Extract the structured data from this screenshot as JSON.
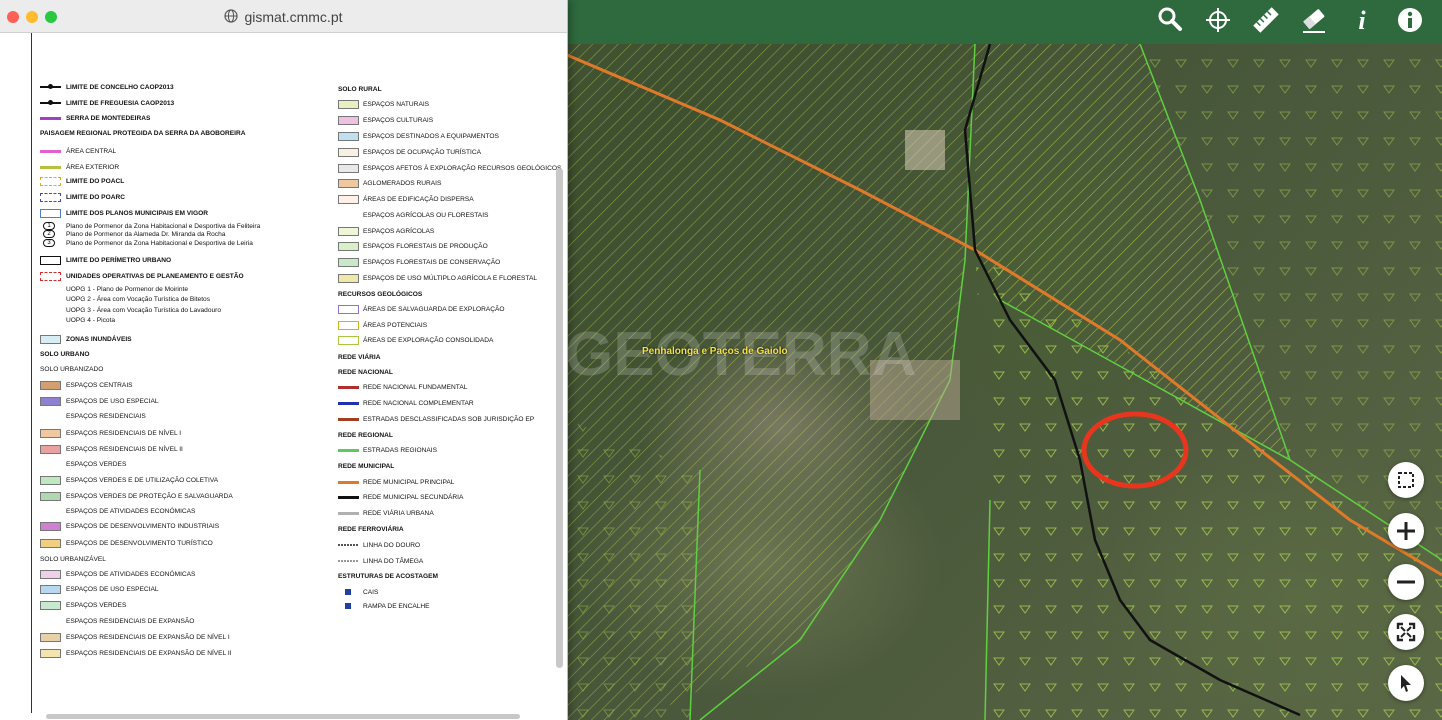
{
  "window": {
    "url": "gismat.cmmc.pt"
  },
  "map": {
    "place_label": "Penhalonga e Paços de Gaiolo"
  },
  "toolbar": {
    "icons": [
      "search-icon",
      "crosshair-icon",
      "ruler-icon",
      "eraser-icon",
      "info-italic-icon",
      "info-circle-icon"
    ]
  },
  "controls": {
    "icons": [
      "select-area-icon",
      "zoom-in-icon",
      "zoom-out-icon",
      "fullscreen-icon",
      "pointer-icon"
    ]
  },
  "legend_left": [
    {
      "text": "LIMITE DE CONCELHO  CAOP2013",
      "bold": true
    },
    {
      "text": "LIMITE DE FREGUESIA  CAOP2013",
      "bold": true
    },
    {
      "text": "SERRA DE MONTEDEIRAS",
      "bold": true
    },
    {
      "text": "PAISAGEM REGIONAL PROTEGIDA DA SERRA DA ABOBOREIRA",
      "bold": true
    },
    {
      "text": "ÁREA CENTRAL",
      "bold": false
    },
    {
      "text": "ÁREA EXTERIOR",
      "bold": false
    },
    {
      "text": "LIMITE DO POACL",
      "bold": true
    },
    {
      "text": "LIMITE DO POARC",
      "bold": true
    },
    {
      "text": "LIMITE DOS PLANOS MUNICIPAIS EM VIGOR",
      "bold": true
    },
    {
      "text": "Plano de Pormenor da Zona Habitacional e Desportiva da Feliteira",
      "bold": false
    },
    {
      "text": "Plano de Pormenor da Alameda Dr. Miranda da Rocha",
      "bold": false
    },
    {
      "text": "Plano de Pormenor da Zona Habitacional e Desportiva de Leiria",
      "bold": false
    },
    {
      "text": "LIMITE DO PERÍMETRO URBANO",
      "bold": true
    },
    {
      "text": "UNIDADES OPERATIVAS DE PLANEAMENTO E GESTÃO",
      "bold": true
    },
    {
      "text": "UOPG 1 - Plano de Pormenor de Moirinte",
      "bold": false
    },
    {
      "text": "UOPG 2 - Área com Vocação Turística de Bitetos",
      "bold": false
    },
    {
      "text": "UOPG 3 - Área com Vocação Turística do Lavadouro",
      "bold": false
    },
    {
      "text": "UOPG 4 - Picota",
      "bold": false
    },
    {
      "text": "ZONAS INUNDÁVEIS",
      "bold": true
    },
    {
      "text": "SOLO URBANO",
      "bold": true
    },
    {
      "text": "SOLO URBANIZADO",
      "bold": false
    },
    {
      "text": "ESPAÇOS CENTRAIS",
      "bold": false
    },
    {
      "text": "ESPAÇOS DE USO ESPECIAL",
      "bold": false
    },
    {
      "text": "ESPAÇOS RESIDENCIAIS",
      "bold": false
    },
    {
      "text": "ESPAÇOS RESIDENCIAIS DE NÍVEL I",
      "bold": false
    },
    {
      "text": "ESPAÇOS RESIDENCIAIS DE NÍVEL II",
      "bold": false
    },
    {
      "text": "ESPAÇOS VERDES",
      "bold": false
    },
    {
      "text": "ESPAÇOS VERDES E DE UTILIZAÇÃO COLETIVA",
      "bold": false
    },
    {
      "text": "ESPAÇOS VERDES DE PROTEÇÃO E SALVAGUARDA",
      "bold": false
    },
    {
      "text": "ESPAÇOS DE ATIVIDADES ECONÓMICAS",
      "bold": false
    },
    {
      "text": "ESPAÇOS DE DESENVOLVIMENTO INDUSTRIAIS",
      "bold": false
    },
    {
      "text": "ESPAÇOS DE DESENVOLVIMENTO TURÍSTICO",
      "bold": false
    },
    {
      "text": "SOLO URBANIZÁVEL",
      "bold": false
    },
    {
      "text": "ESPAÇOS DE ATIVIDADES ECONÓMICAS",
      "bold": false
    },
    {
      "text": "ESPAÇOS DE USO ESPECIAL",
      "bold": false
    },
    {
      "text": "ESPAÇOS VERDES",
      "bold": false
    },
    {
      "text": "ESPAÇOS RESIDENCIAIS DE EXPANSÃO",
      "bold": false
    },
    {
      "text": "ESPAÇOS RESIDENCIAIS DE EXPANSÃO DE NÍVEL I",
      "bold": false
    },
    {
      "text": "ESPAÇOS RESIDENCIAIS DE EXPANSÃO DE NÍVEL II",
      "bold": false
    }
  ],
  "legend_right": [
    {
      "text": "SOLO RURAL",
      "bold": true
    },
    {
      "text": "ESPAÇOS NATURAIS",
      "bold": false
    },
    {
      "text": "ESPAÇOS CULTURAIS",
      "bold": false
    },
    {
      "text": "ESPAÇOS DESTINADOS A EQUIPAMENTOS",
      "bold": false
    },
    {
      "text": "ESPAÇOS DE OCUPAÇÃO TURÍSTICA",
      "bold": false
    },
    {
      "text": "ESPAÇOS AFETOS À EXPLORAÇÃO RECURSOS GEOLÓGICOS",
      "bold": false
    },
    {
      "text": "AGLOMERADOS RURAIS",
      "bold": false
    },
    {
      "text": "ÁREAS DE EDIFICAÇÃO DISPERSA",
      "bold": false
    },
    {
      "text": "ESPAÇOS AGRÍCOLAS OU FLORESTAIS",
      "bold": false
    },
    {
      "text": "ESPAÇOS AGRÍCOLAS",
      "bold": false
    },
    {
      "text": "ESPAÇOS FLORESTAIS DE PRODUÇÃO",
      "bold": false
    },
    {
      "text": "ESPAÇOS FLORESTAIS DE CONSERVAÇÃO",
      "bold": false
    },
    {
      "text": "ESPAÇOS DE USO MÚLTIPLO AGRÍCOLA E FLORESTAL",
      "bold": false
    },
    {
      "text": "RECURSOS GEOLÓGICOS",
      "bold": true
    },
    {
      "text": "ÁREAS DE SALVAGUARDA DE EXPLORAÇÃO",
      "bold": false
    },
    {
      "text": "ÁREAS POTENCIAIS",
      "bold": false
    },
    {
      "text": "ÁREAS DE EXPLORAÇÃO CONSOLIDADA",
      "bold": false
    },
    {
      "text": "REDE VIÁRIA",
      "bold": true
    },
    {
      "text": "REDE NACIONAL",
      "bold": true
    },
    {
      "text": "REDE NACIONAL FUNDAMENTAL",
      "bold": false
    },
    {
      "text": "REDE NACIONAL COMPLEMENTAR",
      "bold": false
    },
    {
      "text": "ESTRADAS DESCLASSIFICADAS SOB JURISDIÇÃO EP",
      "bold": false
    },
    {
      "text": "REDE REGIONAL",
      "bold": true
    },
    {
      "text": "ESTRADAS REGIONAIS",
      "bold": false
    },
    {
      "text": "REDE MUNICIPAL",
      "bold": true
    },
    {
      "text": "REDE MUNICIPAL PRINCIPAL",
      "bold": false
    },
    {
      "text": "REDE MUNICIPAL SECUNDÁRIA",
      "bold": false
    },
    {
      "text": "REDE VIÁRIA URBANA",
      "bold": false
    },
    {
      "text": "REDE FERROVIÁRIA",
      "bold": true
    },
    {
      "text": "LINHA DO DOURO",
      "bold": false
    },
    {
      "text": "LINHA DO TÂMEGA",
      "bold": false
    },
    {
      "text": "ESTRUTURAS DE ACOSTAGEM",
      "bold": true
    },
    {
      "text": "CAIS",
      "bold": false
    },
    {
      "text": "RAMPA DE ENCALHE",
      "bold": false
    }
  ]
}
